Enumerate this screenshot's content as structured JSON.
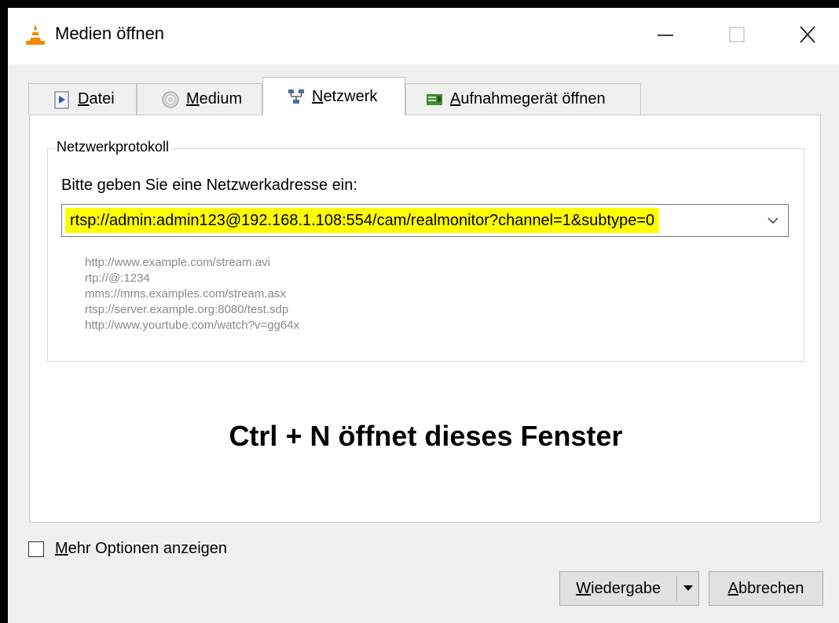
{
  "window": {
    "title": "Medien öffnen"
  },
  "tabs": [
    {
      "pre": "",
      "ul": "D",
      "post": "atei",
      "icon": "file-play-icon"
    },
    {
      "pre": "",
      "ul": "M",
      "post": "edium",
      "icon": "disc-icon"
    },
    {
      "pre": "",
      "ul": "N",
      "post": "etzwerk",
      "icon": "network-icon",
      "active": true
    },
    {
      "pre": "",
      "ul": "A",
      "post": "ufnahmegerät öffnen",
      "icon": "capture-card-icon"
    }
  ],
  "network": {
    "group_label": "Netzwerkprotokoll",
    "prompt": "Bitte geben Sie eine Netzwerkadresse ein:",
    "url_value": "rtsp://admin:admin123@192.168.1.108:554/cam/realmonitor?channel=1&subtype=0",
    "examples": [
      "http://www.example.com/stream.avi",
      "rtp://@:1234",
      "mms://mms.examples.com/stream.asx",
      "rtsp://server.example.org:8080/test.sdp",
      "http://www.yourtube.com/watch?v=gg64x"
    ],
    "highlight_color": "#ffff00"
  },
  "annotation": "Ctrl + N öffnet dieses Fenster",
  "more_options": {
    "ul": "M",
    "rest": "ehr Optionen anzeigen",
    "checked": false
  },
  "buttons": {
    "play_ul": "W",
    "play_rest": "iedergabe",
    "cancel_ul": "A",
    "cancel_rest": "bbrechen"
  }
}
